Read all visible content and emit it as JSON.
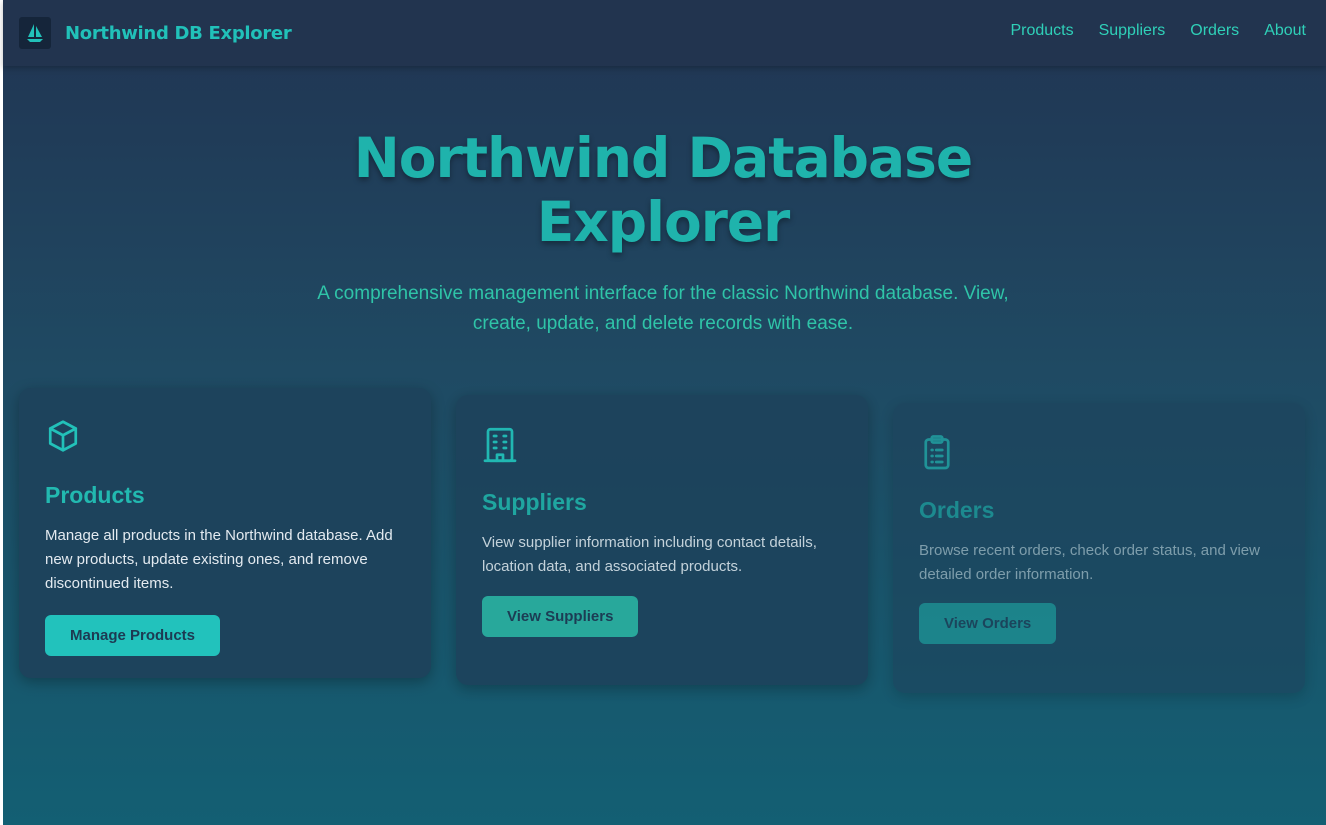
{
  "header": {
    "brand_title": "Northwind DB Explorer",
    "logo_icon": "sailboat-icon",
    "nav": [
      {
        "label": "Products"
      },
      {
        "label": "Suppliers"
      },
      {
        "label": "Orders"
      },
      {
        "label": "About"
      }
    ]
  },
  "hero": {
    "title_line1": "Northwind Database",
    "title_line2": "Explorer",
    "subtitle_line1": "A comprehensive management interface for the classic Northwind database. View,",
    "subtitle_line2": "create, update, and delete records with ease."
  },
  "cards": [
    {
      "icon": "cube-icon",
      "title": "Products",
      "description": "Manage all products in the Northwind database. Add new products, update existing ones, and remove discontinued items.",
      "button_label": "Manage Products"
    },
    {
      "icon": "building-icon",
      "title": "Suppliers",
      "description": "View supplier information including contact details, location data, and associated products.",
      "button_label": "View Suppliers"
    },
    {
      "icon": "clipboard-list-icon",
      "title": "Orders",
      "description": "Browse recent orders, check order status, and view detailed order information.",
      "button_label": "View Orders"
    }
  ],
  "colors": {
    "accent": "#21c1b9",
    "nav_link": "#2fd0b8",
    "navbar_bg": "#22344f",
    "card_bg": "#1d435c"
  }
}
